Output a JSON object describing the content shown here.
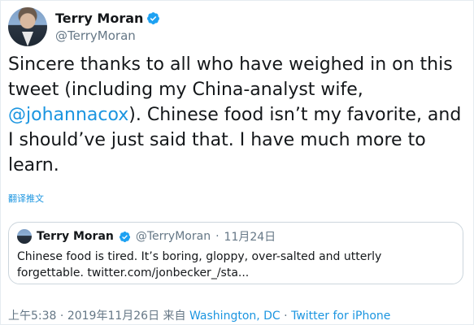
{
  "author": {
    "display_name": "Terry Moran",
    "handle": "@TerryMoran"
  },
  "tweet": {
    "text_before_mention": "Sincere thanks to all who have weighed in on this tweet (including my China-analyst wife, ",
    "mention": "@johannacox",
    "text_after_mention": "). Chinese food isn’t my favorite, and I should’ve just said that. I have much more to learn.",
    "translate_label": "翻译推文"
  },
  "quoted_tweet": {
    "display_name": "Terry Moran",
    "handle": "@TerryMoran",
    "separator": "·",
    "date": "11月24日",
    "text": "Chinese food is tired. It’s boring, gloppy, over-salted and utterly forgettable. twitter.com/jonbecker_/sta..."
  },
  "footer": {
    "time": "上午5:38",
    "separator1": "·",
    "date": "2019年11月26日",
    "from_label": "来自",
    "location": "Washington, DC",
    "separator2": "·",
    "client": "Twitter for iPhone"
  },
  "colors": {
    "link": "#1b95e0",
    "secondary_text": "#657786",
    "primary_text": "#14171a",
    "border": "#ccd6dd"
  },
  "icons": {
    "verified": "verified-badge-icon"
  }
}
